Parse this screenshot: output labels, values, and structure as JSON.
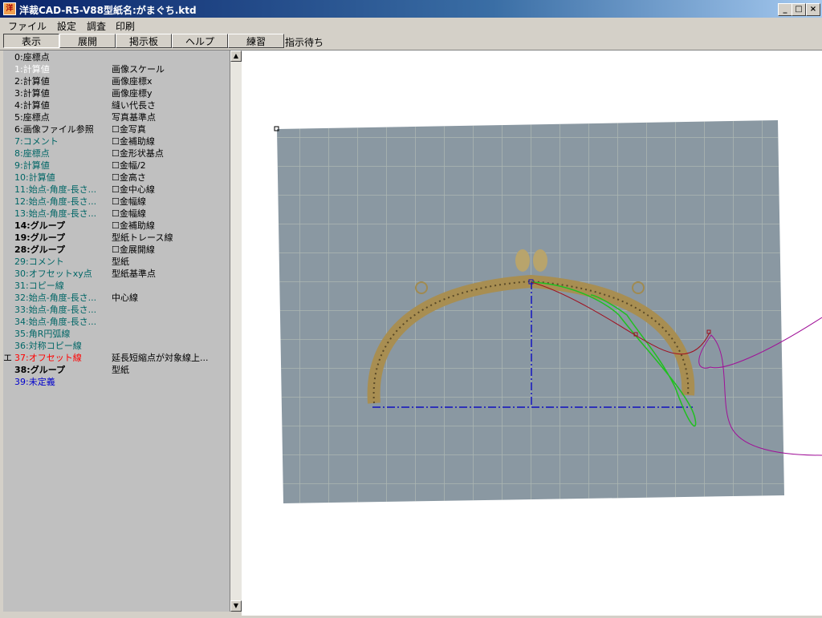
{
  "window": {
    "title": "洋裁CAD-R5-V88型紙名:がまぐち.ktd",
    "icon": "app-icon",
    "controls": [
      "_",
      "□",
      "×"
    ]
  },
  "menu": [
    "ファイル",
    "設定",
    "調査",
    "印刷"
  ],
  "toolbar": {
    "buttons": [
      "表示",
      "展開",
      "掲示板",
      "ヘルプ",
      "練習"
    ],
    "active": "表示",
    "status": "指示待ち"
  },
  "items": [
    {
      "key": "0:座標点",
      "value": "",
      "color": "#000000",
      "bold": false,
      "marker": ""
    },
    {
      "key": "1:計算値",
      "value": "画像スケール",
      "color": "#ffffff",
      "bold": false,
      "marker": ""
    },
    {
      "key": "2:計算値",
      "value": "画像座標x",
      "color": "#000000",
      "bold": false,
      "marker": ""
    },
    {
      "key": "3:計算値",
      "value": "画像座標y",
      "color": "#000000",
      "bold": false,
      "marker": ""
    },
    {
      "key": "4:計算値",
      "value": "縫い代長さ",
      "color": "#000000",
      "bold": false,
      "marker": ""
    },
    {
      "key": "5:座標点",
      "value": "写真基準点",
      "color": "#000000",
      "bold": false,
      "marker": ""
    },
    {
      "key": "6:画像ファイル参照",
      "value": "☐金写真",
      "color": "#000000",
      "bold": false,
      "marker": ""
    },
    {
      "key": "7:コメント",
      "value": "☐金補助線",
      "color": "#006666",
      "bold": false,
      "marker": ""
    },
    {
      "key": "8:座標点",
      "value": "☐金形状基点",
      "color": "#006666",
      "bold": false,
      "marker": ""
    },
    {
      "key": "9:計算値",
      "value": "☐金幅/2",
      "color": "#006666",
      "bold": false,
      "marker": ""
    },
    {
      "key": "10:計算値",
      "value": "☐金高さ",
      "color": "#006666",
      "bold": false,
      "marker": ""
    },
    {
      "key": "11:始点-角度-長さ...",
      "value": "☐金中心線",
      "color": "#006666",
      "bold": false,
      "marker": ""
    },
    {
      "key": "12:始点-角度-長さ...",
      "value": "☐金幅線",
      "color": "#006666",
      "bold": false,
      "marker": ""
    },
    {
      "key": "13:始点-角度-長さ...",
      "value": "☐金幅線",
      "color": "#006666",
      "bold": false,
      "marker": ""
    },
    {
      "key": "14:グループ",
      "value": "☐金補助線",
      "color": "#000000",
      "bold": true,
      "marker": ""
    },
    {
      "key": "19:グループ",
      "value": "型紙トレース線",
      "color": "#000000",
      "bold": true,
      "marker": ""
    },
    {
      "key": "28:グループ",
      "value": "☐金展開線",
      "color": "#000000",
      "bold": true,
      "marker": ""
    },
    {
      "key": "29:コメント",
      "value": "型紙",
      "color": "#006666",
      "bold": false,
      "marker": ""
    },
    {
      "key": "30:オフセットxy点",
      "value": "型紙基準点",
      "color": "#006666",
      "bold": false,
      "marker": ""
    },
    {
      "key": "31:コピー線",
      "value": "",
      "color": "#006666",
      "bold": false,
      "marker": ""
    },
    {
      "key": "32:始点-角度-長さ...",
      "value": "中心線",
      "color": "#006666",
      "bold": false,
      "marker": ""
    },
    {
      "key": "33:始点-角度-長さ...",
      "value": "",
      "color": "#006666",
      "bold": false,
      "marker": ""
    },
    {
      "key": "34:始点-角度-長さ...",
      "value": "",
      "color": "#006666",
      "bold": false,
      "marker": ""
    },
    {
      "key": "35:角R円弧線",
      "value": "",
      "color": "#006666",
      "bold": false,
      "marker": ""
    },
    {
      "key": "36:対称コピー線",
      "value": "",
      "color": "#006666",
      "bold": false,
      "marker": ""
    },
    {
      "key": "37:オフセット線",
      "value": "延長短縮点が対象線上...",
      "color": "#ff0000",
      "bold": false,
      "marker": "エ"
    },
    {
      "key": "38:グループ",
      "value": "型紙",
      "color": "#000000",
      "bold": true,
      "marker": ""
    },
    {
      "key": "39:未定義",
      "value": "",
      "color": "#0000cc",
      "bold": false,
      "marker": ""
    }
  ],
  "scrollbar": {
    "up": "▲",
    "down": "▼"
  }
}
